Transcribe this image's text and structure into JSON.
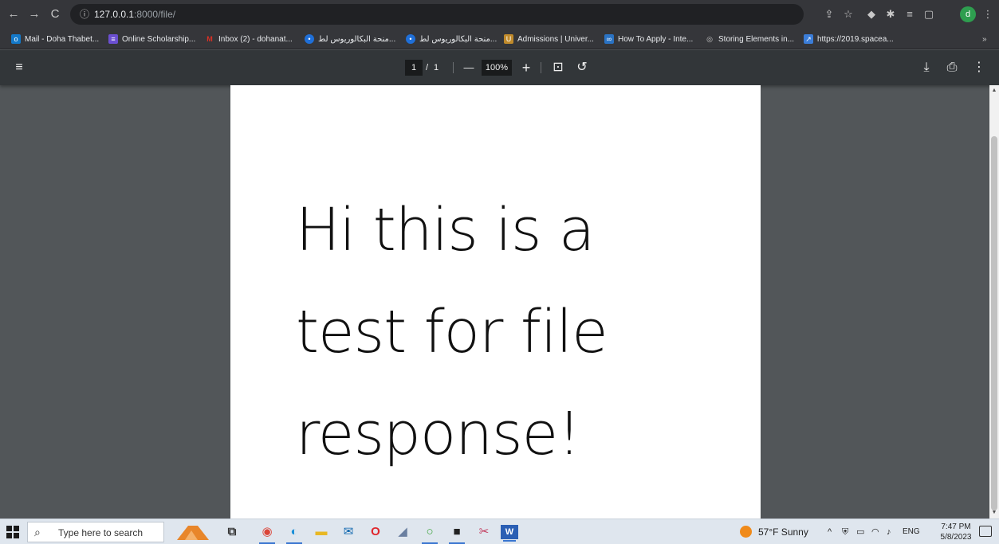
{
  "browser": {
    "back_glyph": "←",
    "forward_glyph": "→",
    "reload_glyph": "C",
    "url_host": "127.0.0.1",
    "url_rest": ":8000/file/",
    "info_glyph": "ⓘ",
    "profile_letter": "d",
    "toolbar_glyphs": {
      "share": "⇪",
      "star": "☆",
      "extension_a": "◆",
      "extension_b": "✱",
      "reading_list": "≡",
      "side_panel": "▢",
      "menu": "⋮"
    },
    "bookmarks": [
      {
        "label": "Mail - Doha Thabet...",
        "icon": "outlook-icon",
        "color": "#1479c9",
        "glyph": "o"
      },
      {
        "label": "Online Scholarship...",
        "icon": "list-icon",
        "color": "#6b4fd1",
        "glyph": "≡"
      },
      {
        "label": "Inbox (2) - dohanat...",
        "icon": "gmail-icon",
        "color": "#d93025",
        "glyph": "M"
      },
      {
        "label": "منحة البكالوريوس لط...",
        "icon": "pin-icon",
        "color": "#1f6fd8",
        "glyph": "•"
      },
      {
        "label": "منحة البكالوريوس لط...",
        "icon": "pin-icon",
        "color": "#1f6fd8",
        "glyph": "•"
      },
      {
        "label": "Admissions | Univer...",
        "icon": "university-icon",
        "color": "#c08a2b",
        "glyph": "U"
      },
      {
        "label": "How To Apply - Inte...",
        "icon": "apply-icon",
        "color": "#2a73c4",
        "glyph": "∞"
      },
      {
        "label": "Storing Elements in...",
        "icon": "globe-icon",
        "color": "#5f6368",
        "glyph": "◎"
      },
      {
        "label": "https://2019.spacea...",
        "icon": "rocket-icon",
        "color": "#3b7dd8",
        "glyph": "↗"
      }
    ],
    "more_bookmarks_glyph": "»"
  },
  "pdf_toolbar": {
    "menu_glyph": "≡",
    "page_current": "1",
    "page_separator": "/",
    "page_total": "1",
    "zoom_out_glyph": "—",
    "zoom_level": "100%",
    "zoom_in_glyph": "+",
    "fit_glyph": "⊡",
    "rotate_glyph": "↺",
    "download_glyph": "⤓",
    "print_glyph": "⎙",
    "more_glyph": "⋮"
  },
  "document": {
    "lines": [
      "Hi this is a",
      "test for file",
      "response!"
    ]
  },
  "scrollbar": {
    "up_glyph": "▲",
    "down_glyph": "▼"
  },
  "taskbar": {
    "search_glyph": "⌕",
    "search_placeholder": "Type here to search",
    "apps": [
      {
        "name": "taskview-icon",
        "glyph": "⧉",
        "color": "#333333"
      },
      {
        "name": "chrome-icon",
        "glyph": "◉",
        "color": "#db4437"
      },
      {
        "name": "edge-icon",
        "glyph": "◐",
        "color": "#1a8fd8"
      },
      {
        "name": "file-explorer-icon",
        "glyph": "▬",
        "color": "#e8b824"
      },
      {
        "name": "mail-icon",
        "glyph": "✉",
        "color": "#0a64ad"
      },
      {
        "name": "opera-icon",
        "glyph": "O",
        "color": "#e0262b"
      },
      {
        "name": "app-icon",
        "glyph": "◢",
        "color": "#6a7fa0"
      },
      {
        "name": "ring-app-icon",
        "glyph": "○",
        "color": "#3ba33b"
      },
      {
        "name": "terminal-icon",
        "glyph": "■",
        "color": "#222222"
      },
      {
        "name": "snipping-icon",
        "glyph": "✂",
        "color": "#c23a5c"
      },
      {
        "name": "word-icon",
        "glyph": "W",
        "color": "#2b5fb4"
      }
    ],
    "weather": "57°F  Sunny",
    "tray_up_glyph": "^",
    "language": "ENG",
    "time": "7:47 PM",
    "date": "5/8/2023"
  }
}
